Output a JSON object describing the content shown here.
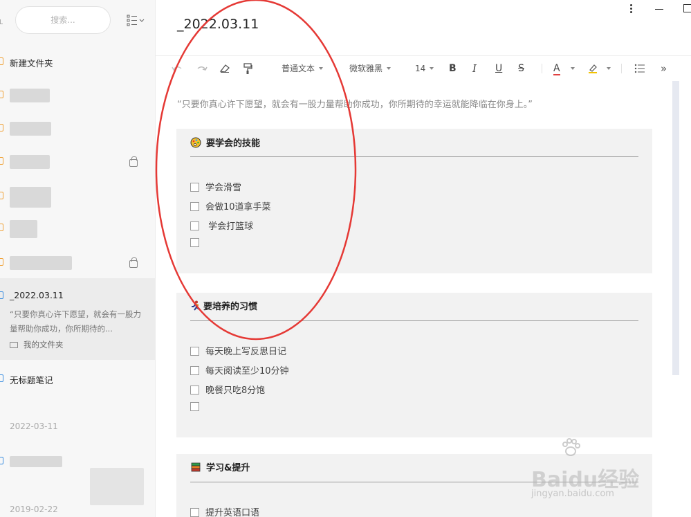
{
  "sidebar": {
    "search_placeholder": "搜索...",
    "folders": [
      {
        "label": "新建文件夹",
        "blurred": false,
        "locked": false
      },
      {
        "label": "",
        "blurred": true,
        "locked": false
      },
      {
        "label": "",
        "blurred": true,
        "locked": false
      },
      {
        "label": "",
        "blurred": true,
        "locked": true
      },
      {
        "label": "",
        "blurred": true,
        "locked": false
      },
      {
        "label": "",
        "blurred": true,
        "locked": false
      },
      {
        "label": "",
        "blurred": true,
        "locked": true
      }
    ],
    "selected_note": {
      "title": "_2022.03.11",
      "snippet": "“只要你真心许下愿望，就会有一股力量帮助你成功，你所期待的...",
      "folder": "我的文件夹"
    },
    "untitled_note": "无标题笔记",
    "dates": [
      "2022-03-11",
      "2019-02-22"
    ]
  },
  "editor": {
    "title": "_2022.03.11",
    "toolbar": {
      "paragraph_style": "普通文本",
      "font_family": "微软雅黑",
      "font_size": "14",
      "bold": "B",
      "italic": "I",
      "underline": "U",
      "strike": "S",
      "font_color": "A",
      "more": "»"
    },
    "quote": "“只要你真心许下愿望，就会有一股力量帮助你成功，你所期待的幸运就能降临在你身上。”",
    "sections": [
      {
        "title": "要学会的技能",
        "icon": "palette-icon",
        "items": [
          "学会滑雪",
          "会做10道拿手菜",
          " 学会打篮球",
          ""
        ]
      },
      {
        "title": "要培养的习惯",
        "icon": "runner-icon",
        "items": [
          "每天晚上写反思日记",
          "每天阅读至少10分钟",
          "晚餐只吃8分饱",
          ""
        ]
      },
      {
        "title": "学习&提升",
        "icon": "books-icon",
        "items": [
          "提升英语口语"
        ]
      }
    ]
  },
  "watermark": {
    "brand": "Baidu经验",
    "url": "jingyan.baidu.com"
  },
  "colors": {
    "annotation_oval": "#e53935",
    "folder_icon": "#f0a33a",
    "note_icon": "#3d8fe0"
  }
}
